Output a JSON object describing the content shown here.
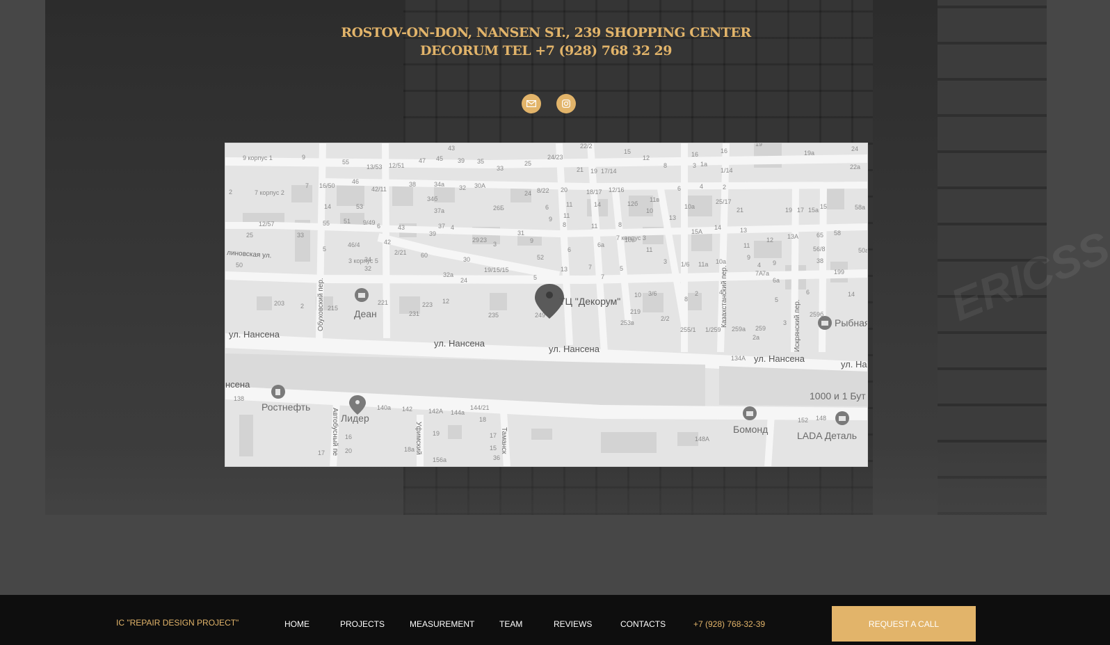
{
  "address": {
    "line1": "ROSTOV-ON-DON, NANSEN ST., 239 SHOPPING CENTER",
    "line2": "DECORUM TEL +7 (928) 768 32 29"
  },
  "social": [
    {
      "icon": "mail-icon"
    },
    {
      "icon": "instagram-icon"
    }
  ],
  "map": {
    "main_marker": "ТЦ \"Декорум\"",
    "streets": [
      "ул. Нансена",
      "ул. Нансена",
      "ул. Нансена",
      "ул. Нансена",
      "ул. На",
      "нсена",
      "Казахстанский пер.",
      "Обуховский пер.",
      "Искрянский пер.",
      "Автобусный пе",
      "Уфимский",
      "Таманск",
      "линовская ул."
    ],
    "pois": [
      "Деан",
      "Рыбная",
      "Ростнефть",
      "Лидер",
      "Бомонд",
      "LADA Деталь",
      "1000 и 1 Бут"
    ],
    "house_numbers": [
      "9 корпус 1",
      "9",
      "43",
      "22/2",
      "15",
      "12",
      "16",
      "16",
      "19",
      "19а",
      "24",
      "55",
      "47",
      "45",
      "39",
      "35",
      "13/53",
      "12/51",
      "33",
      "25",
      "24/23",
      "21",
      "19",
      "17/14",
      "8",
      "3",
      "1а",
      "1/14",
      "22а",
      "2",
      "7 корпус 2",
      "7",
      "16/50",
      "46",
      "42/11",
      "38",
      "34а",
      "32",
      "30А",
      "24",
      "8/22",
      "20",
      "18/17",
      "12/16",
      "6",
      "4",
      "2",
      "14",
      "53",
      "34б",
      "37а",
      "26Б",
      "6",
      "11",
      "14",
      "12б",
      "11в",
      "10",
      "10а",
      "25/17",
      "21",
      "19",
      "17",
      "15а",
      "15",
      "58а",
      "12/57",
      "55",
      "51",
      "9/49",
      "6",
      "43",
      "39",
      "37",
      "4",
      "9",
      "11",
      "8",
      "11",
      "8",
      "13",
      "14",
      "13",
      "13А",
      "65",
      "58",
      "25",
      "33",
      "31",
      "29",
      "23",
      "3",
      "9",
      "6",
      "6а",
      "7 корпус 3",
      "10в",
      "11",
      "15А",
      "11",
      "12",
      "56/8",
      "50а",
      "5",
      "46/4",
      "42",
      "2/21",
      "60",
      "52",
      "50",
      "3 корпус 5",
      "34",
      "32",
      "30",
      "19/1",
      "5/15",
      "13",
      "7",
      "5",
      "3",
      "1/6",
      "11а",
      "10а",
      "9",
      "9",
      "4",
      "38",
      "32а",
      "24",
      "5",
      "7",
      "7А",
      "7а",
      "199",
      "203",
      "2",
      "215",
      "221",
      "223",
      "12",
      "10",
      "3/6",
      "2",
      "4",
      "8",
      "6а",
      "5",
      "6",
      "14",
      "219",
      "231",
      "235",
      "249",
      "253в",
      "2/2",
      "255/1",
      "1/259",
      "259а",
      "259",
      "2а",
      "3",
      "259б",
      "134А",
      "138",
      "140а",
      "142",
      "142А",
      "144а",
      "144/21",
      "18",
      "16",
      "20",
      "19",
      "17",
      "15",
      "36",
      "17",
      "18а",
      "156а",
      "152",
      "148",
      "148А"
    ]
  },
  "footer": {
    "brand": "IC \"REPAIR DESIGN PROJECT\"",
    "nav": [
      "HOME",
      "PROJECTS",
      "MEASUREMENT",
      "TEAM",
      "REVIEWS",
      "CONTACTS"
    ],
    "phone": "+7 (928) 768-32-39",
    "cta_label": "REQUEST A CALL"
  },
  "colors": {
    "accent": "#e2b46a",
    "footer_bg": "#0e0e0e",
    "map_bg": "#e4e4e4"
  }
}
